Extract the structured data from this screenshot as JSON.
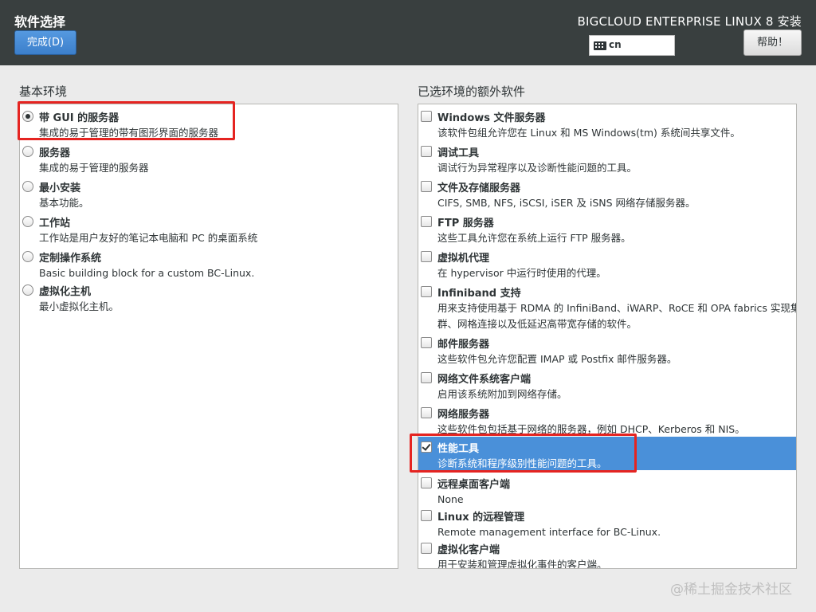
{
  "header": {
    "title": "软件选择",
    "done_button": "完成(D)",
    "product": "BIGCLOUD ENTERPRISE LINUX 8 安装",
    "keyboard_layout": "cn",
    "help_button": "帮助！"
  },
  "base_env": {
    "heading": "基本环境",
    "items": [
      {
        "title": "带 GUI 的服务器",
        "desc": "集成的易于管理的带有图形界面的服务器",
        "selected": true
      },
      {
        "title": "服务器",
        "desc": "集成的易于管理的服务器",
        "selected": false
      },
      {
        "title": "最小安装",
        "desc": "基本功能。",
        "selected": false
      },
      {
        "title": "工作站",
        "desc": "工作站是用户友好的笔记本电脑和 PC 的桌面系统",
        "selected": false
      },
      {
        "title": "定制操作系统",
        "desc": "Basic building block for a custom BC-Linux.",
        "selected": false
      },
      {
        "title": "虚拟化主机",
        "desc": "最小虚拟化主机。",
        "selected": false
      }
    ]
  },
  "addons": {
    "heading": "已选环境的额外软件",
    "items": [
      {
        "title": "Windows 文件服务器",
        "desc": "该软件包组允许您在 Linux 和 MS Windows(tm) 系统间共享文件。",
        "checked": false
      },
      {
        "title": "调试工具",
        "desc": "调试行为异常程序以及诊断性能问题的工具。",
        "checked": false
      },
      {
        "title": "文件及存储服务器",
        "desc": "CIFS, SMB, NFS, iSCSI, iSER 及 iSNS 网络存储服务器。",
        "checked": false
      },
      {
        "title": "FTP 服务器",
        "desc": "这些工具允许您在系统上运行 FTP 服务器。",
        "checked": false
      },
      {
        "title": "虚拟机代理",
        "desc": "在 hypervisor 中运行时使用的代理。",
        "checked": false
      },
      {
        "title": "Infiniband 支持",
        "desc": "用来支持使用基于 RDMA 的 InfiniBand、iWARP、RoCE 和 OPA fabrics 实现集",
        "desc2": "群、网格连接以及低延迟高带宽存储的软件。",
        "checked": false
      },
      {
        "title": "邮件服务器",
        "desc": "这些软件包允许您配置 IMAP 或 Postfix 邮件服务器。",
        "checked": false
      },
      {
        "title": "网络文件系统客户端",
        "desc": "启用该系统附加到网络存储。",
        "checked": false
      },
      {
        "title": "网络服务器",
        "desc": "这些软件包包括基于网络的服务器，例如 DHCP、Kerberos 和 NIS。",
        "checked": false
      },
      {
        "title": "性能工具",
        "desc": "诊断系统和程序级别性能问题的工具。",
        "checked": true
      },
      {
        "title": "远程桌面客户端",
        "desc": "None",
        "checked": false
      },
      {
        "title": "Linux 的远程管理",
        "desc": "Remote management interface for BC-Linux.",
        "checked": false
      },
      {
        "title": "虚拟化客户端",
        "desc": "用于安装和管理虚拟化事件的客户端。",
        "checked": false
      }
    ]
  },
  "watermark": "@稀土掘金技术社区"
}
